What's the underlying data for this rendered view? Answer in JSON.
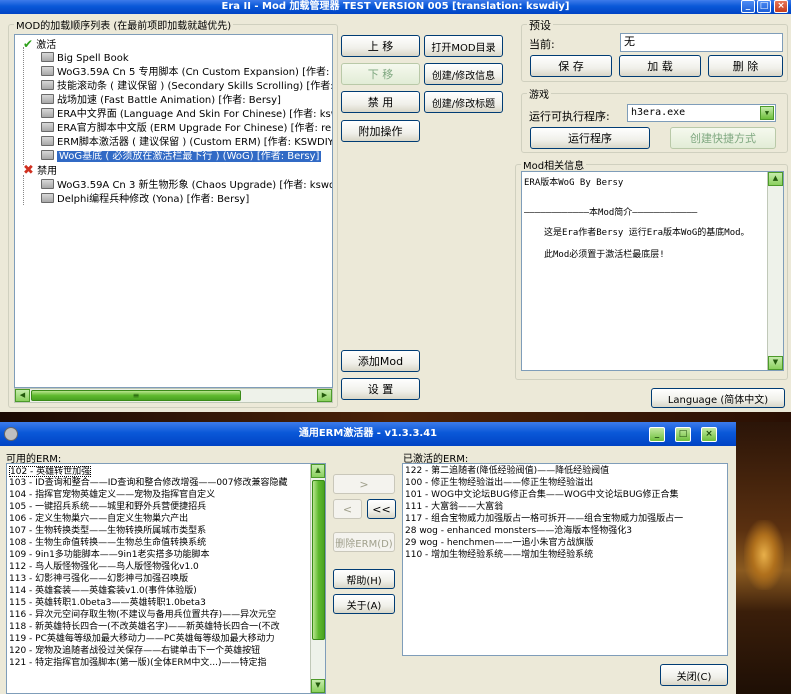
{
  "win1": {
    "title": "Era II - Mod 加载管理器 TEST VERSION 005 [translation: kswdiy]",
    "mod_list_label": "MOD的加载顺序列表 (在最前项即加载就越优先)",
    "active_group": "激活",
    "inactive_group": "禁用",
    "active_mods": [
      "Big Spell Book",
      "WoG3.59A Cn 5 专用脚本 (Cn Custom Expansion) [作者: Hunter",
      "技能滚动条 ( 建议保留 ) (Secondary Skills Scrolling) [作者: Ber",
      "战场加速 (Fast Battle Animation) [作者: Bersy]",
      "ERA中文界面 (Language And Skin For Chinese) [作者: kswdiy]",
      "ERA官方脚本中文版 (ERM Upgrade For Chinese) [作者: renglinf",
      "ERM脚本激活器 ( 建议保留 ) (Custom ERM) [作者: KSWDIY &",
      "WoG基底 ( 必须放在激活栏最下行 ) (WoG) [作者: Bersy]"
    ],
    "inactive_mods": [
      "WoG3.59A Cn 3 新生物形象 (Chaos Upgrade) [作者: kswdiy]",
      "Delphi编程兵种修改 (Yona) [作者: Bersy]"
    ],
    "buttons": {
      "move_up": "上 移",
      "move_down": "下 移",
      "disable": "禁 用",
      "extra_ops": "附加操作",
      "open_dir": "打开MOD目录",
      "edit_info": "创建/修改信息",
      "edit_title": "创建/修改标题",
      "add_mod": "添加Mod",
      "settings": "设 置"
    },
    "preset": {
      "label": "预设",
      "current_label": "当前:",
      "current_value": "无",
      "save": "保 存",
      "load": "加 载",
      "delete": "删 除"
    },
    "run": {
      "label": "游戏",
      "exe_label": "运行可执行程序:",
      "exe_value": "h3era.exe",
      "run_button": "运行程序",
      "shortcut_button": "创建快捷方式"
    },
    "info": {
      "label": "Mod相关信息",
      "line1": "ERA版本WoG By Bersy",
      "line2": "————————————本Mod简介————————————",
      "line3": "这是Era作者Bersy 运行Era版本WoG的基底Mod。",
      "line4": "此Mod必须置于激活栏最底层!"
    },
    "language_button": "Language (简体中文)"
  },
  "win2": {
    "title": "通用ERM激活器 - v1.3.3.41",
    "available_label": "可用的ERM:",
    "activated_label": "已激活的ERM:",
    "available": [
      "102 - 英雄转世加强",
      "103 - ID查询和整合——ID查询和整合修改增强——007修改兼容隐藏",
      "104 - 指挥官宠物英雄定义——宠物及指挥官自定义",
      "105 - 一键招兵系统——城里和野外兵营便捷招兵",
      "106 - 定义生物巢穴——自定义生物巢穴产出",
      "107 - 生物转换类型——生物转换所属城市类型系",
      "108 - 生物生命值转换——生物总生命值转换系统",
      "109 - 9in1多功能脚本——9in1老实搭多功能脚本",
      "112 - 鸟人版怪物强化——鸟人版怪物强化v1.0",
      "113 - 幻影神弓强化——幻影神弓加强召唤版",
      "114 - 英雄套装——英雄套装v1.0(事件体验版)",
      "115 - 英雄转职1.0beta3——英雄转职1.0beta3",
      "116 - 异次元空间存取生物(不建议与备用兵位置共存)——异次元空",
      "118 - 新英雄特长四合一(不改英雄名字)——新英雄特长四合一(不改",
      "119 - PC英雄每等级加最大移动力——PC英雄每等级加最大移动力",
      "120 - 宠物及追随者战役过关保存——右键单击下一个英雄按钮",
      "121 - 特定指挥官加强脚本(第一版)(全体ERM中文...)——特定指"
    ],
    "activated": [
      "122 - 第二追随者(降低经验阀值)——降低经验阀值",
      "100 - 修正生物经验溢出——修正生物经验溢出",
      "101 - WOG中文论坛BUG修正合集——WOG中文论坛BUG修正合集",
      "111 - 大富翁——大富翁",
      "117 - 组合宝物威力加强版占一格可拆开——组合宝物威力加强版占一",
      "28 wog - enhanced monsters——沧海版本怪物强化3",
      "29 wog - henchmen——一追小朱官方战旗版",
      "110 - 增加生物经验系统——增加生物经验系统"
    ],
    "buttons": {
      "add": ">",
      "remove": "<",
      "remove_all": "<<",
      "delete_erm": "删除ERM(D)",
      "help": "帮助(H)",
      "about": "关于(A)",
      "close": "关闭(C)"
    }
  }
}
